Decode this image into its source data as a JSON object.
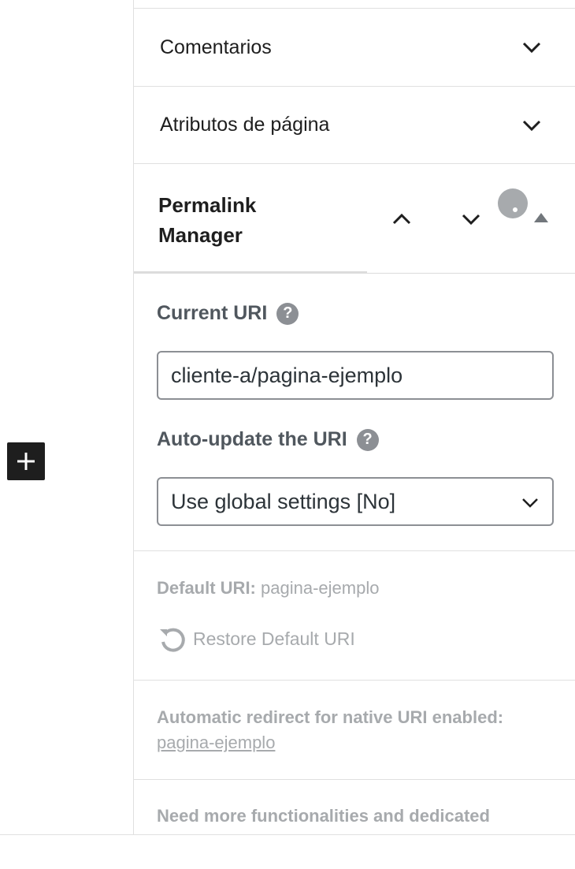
{
  "panels": {
    "comments_label": "Comentarios",
    "attributes_label": "Atributos de página"
  },
  "permalink_manager": {
    "title_line1": "Permalink",
    "title_line2": "Manager",
    "current_uri_label": "Current URI",
    "current_uri_value": "cliente-a/pagina-ejemplo",
    "help_glyph": "?",
    "auto_update_label": "Auto-update the URI",
    "auto_update_selected": "Use global settings [No]",
    "default_uri_label": "Default URI:",
    "default_uri_value": "pagina-ejemplo",
    "restore_label": "Restore Default URI",
    "redirect_label": "Automatic redirect for native URI enabled:",
    "redirect_link": "pagina-ejemplo",
    "more_label": "Need more functionalities and dedicated"
  },
  "icons": {
    "add_block": "plus-icon",
    "chevron_down": "chevron-down-icon",
    "chevron_up": "chevron-up-icon",
    "help": "question-circle-icon",
    "restore": "undo-icon",
    "collapse": "triangle-up-icon"
  },
  "colors": {
    "dark": "#1e1e1e",
    "label": "#50575e",
    "muted": "#a7aaad",
    "border": "#e0e0e0",
    "help_bg": "#8c8f94"
  }
}
